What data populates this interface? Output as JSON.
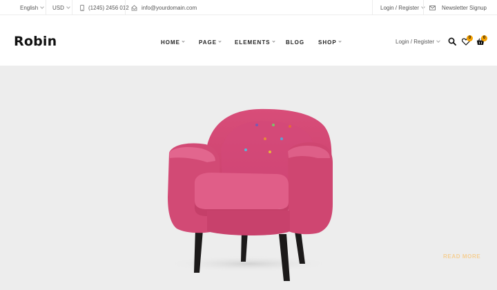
{
  "topbar": {
    "language": "English",
    "currency": "USD",
    "phone": "(1245) 2456 012",
    "email": "info@yourdomain.com",
    "login": "Login / Register",
    "newsletter": "Newsletter Signup"
  },
  "header": {
    "logo": "Robin",
    "nav": [
      {
        "label": "HOME"
      },
      {
        "label": "PAGE"
      },
      {
        "label": "ELEMENTS"
      },
      {
        "label": "BLOG"
      },
      {
        "label": "SHOP"
      }
    ],
    "login": "Login / Register",
    "wishlist_count": "0",
    "cart_count": "0"
  },
  "hero": {
    "read_more": "READ MORE"
  },
  "colors": {
    "accent": "#f5a100",
    "hero_bg": "#ededed",
    "chair": "#d94f7a"
  },
  "icons": [
    "phone-icon",
    "email-icon",
    "mail-icon",
    "search-icon",
    "heart-icon",
    "cart-icon"
  ]
}
